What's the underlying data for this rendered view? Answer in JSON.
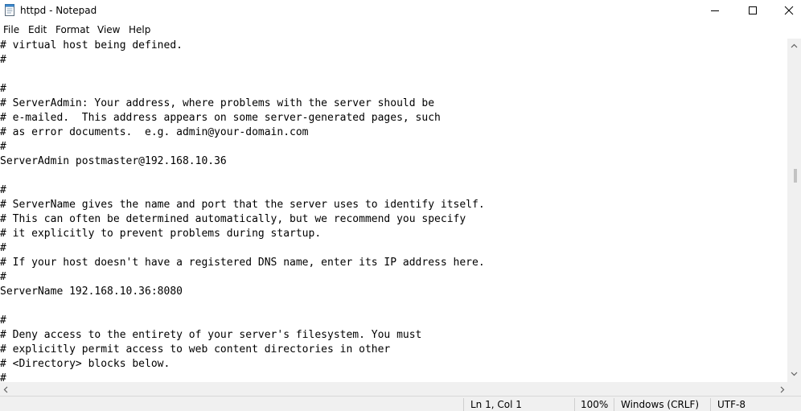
{
  "window": {
    "title": "httpd - Notepad"
  },
  "menu": {
    "file": "File",
    "edit": "Edit",
    "format": "Format",
    "view": "View",
    "help": "Help"
  },
  "editor": {
    "lines": [
      "# virtual host being defined.",
      "#",
      "",
      "#",
      "# ServerAdmin: Your address, where problems with the server should be",
      "# e-mailed.  This address appears on some server-generated pages, such",
      "# as error documents.  e.g. admin@your-domain.com",
      "#",
      "ServerAdmin postmaster@192.168.10.36",
      "",
      "#",
      "# ServerName gives the name and port that the server uses to identify itself.",
      "# This can often be determined automatically, but we recommend you specify",
      "# it explicitly to prevent problems during startup.",
      "#",
      "# If your host doesn't have a registered DNS name, enter its IP address here.",
      "#",
      "ServerName 192.168.10.36:8080",
      "",
      "#",
      "# Deny access to the entirety of your server's filesystem. You must",
      "# explicitly permit access to web content directories in other",
      "# <Directory> blocks below.",
      "#"
    ]
  },
  "status": {
    "position": "Ln 1, Col 1",
    "zoom": "100%",
    "line_ending": "Windows (CRLF)",
    "encoding": "UTF-8"
  },
  "icons": {
    "app": "notepad-icon",
    "minimize": "minimize-icon",
    "maximize": "maximize-icon",
    "close": "close-icon"
  }
}
